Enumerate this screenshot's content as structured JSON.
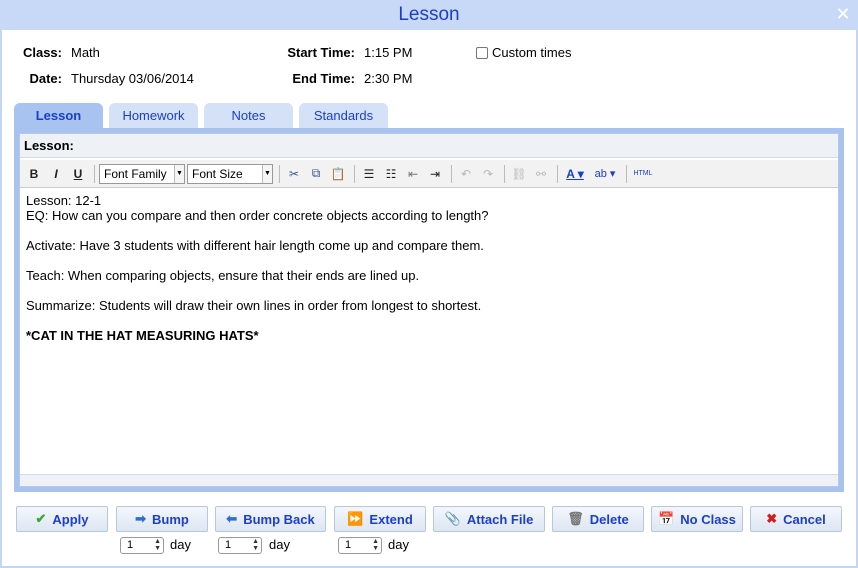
{
  "window": {
    "title": "Lesson"
  },
  "info": {
    "class_label": "Class:",
    "class_value": "Math",
    "date_label": "Date:",
    "date_value": "Thursday 03/06/2014",
    "start_label": "Start Time:",
    "start_value": "1:15 PM",
    "end_label": "End Time:",
    "end_value": "2:30 PM",
    "custom_times_label": "Custom times"
  },
  "tabs": [
    {
      "label": "Lesson",
      "active": true
    },
    {
      "label": "Homework",
      "active": false
    },
    {
      "label": "Notes",
      "active": false
    },
    {
      "label": "Standards",
      "active": false
    }
  ],
  "panel": {
    "label": "Lesson:"
  },
  "toolbar": {
    "font_family": "Font Family",
    "font_size": "Font Size",
    "bold": "B",
    "italic": "I",
    "underline": "U",
    "html": "HTML"
  },
  "editor": {
    "lines": [
      "Lesson: 12-1",
      "EQ: How can you compare and then order concrete objects according to length?",
      "Activate: Have 3 students with different hair length come up and compare them.",
      "Teach: When comparing objects, ensure that their ends are lined up.",
      "Summarize: Students will draw their own lines in order from longest to shortest.",
      "*CAT IN THE HAT MEASURING HATS*"
    ]
  },
  "buttons": {
    "apply": "Apply",
    "bump": "Bump",
    "bump_back": "Bump Back",
    "extend": "Extend",
    "attach_file": "Attach File",
    "delete": "Delete",
    "no_class": "No Class",
    "cancel": "Cancel"
  },
  "steppers": {
    "bump_value": "1",
    "bump_back_value": "1",
    "extend_value": "1",
    "unit": "day"
  },
  "colors": {
    "accent": "#1a3fc9",
    "tab_active": "#a9c3f0",
    "apply_icon": "#3aa832",
    "cancel_icon": "#d41c1c"
  }
}
